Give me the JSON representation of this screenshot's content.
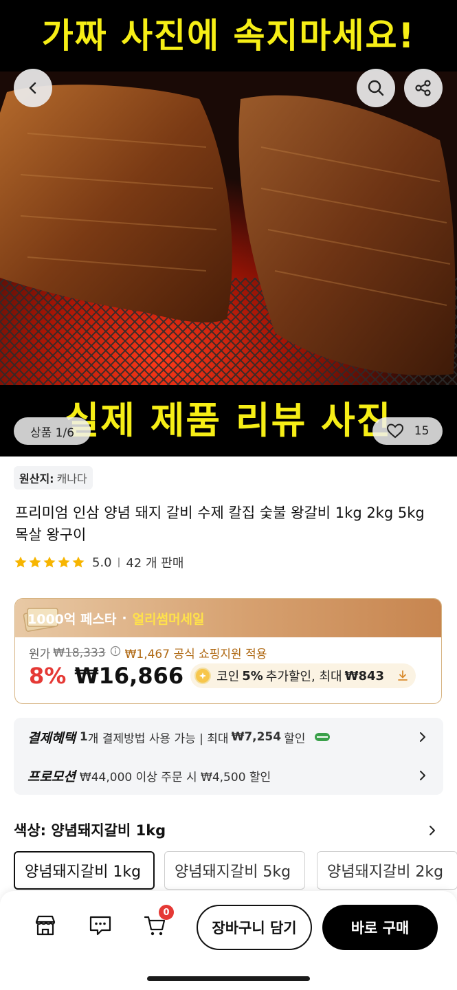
{
  "hero": {
    "banner_top": "가짜 사진에 속지마세요!",
    "banner_bottom": "실제 제품 리뷰 사진",
    "image_counter": "상품 1/6",
    "like_count": "15",
    "back_icon": "chevron-left-icon",
    "search_icon": "search-icon",
    "share_icon": "share-icon"
  },
  "product": {
    "origin_label": "원산지:",
    "origin_value": "캐나다",
    "title": "프리미엄 인삼 양념 돼지 갈비 수제 칼집 숯불 왕갈비 1kg 2kg 5kg 목살 왕구이",
    "rating": "5.0",
    "rating_stars": 5,
    "sales": "42 개 판매"
  },
  "pricing": {
    "festa_label": "1000억 페스타",
    "festa_dot": "·",
    "festa_sale": "얼리썸머세일",
    "original_label": "원가",
    "original_price": "₩18,333",
    "subsidy": "₩1,467 공식 쇼핑지원 적용",
    "discount_pct": "8%",
    "final_price": "₩16,866",
    "coin_text_prefix": "코인",
    "coin_pct": "5%",
    "coin_text_mid": "추가할인, 최대",
    "coin_max": "₩843",
    "accent_color": "#e53935"
  },
  "benefits": {
    "payment_label": "결제혜택",
    "payment_count": "1",
    "payment_text1": "개 결제방법 사용 가능 | 최대",
    "payment_amount": "₩7,254",
    "payment_text2": "할인",
    "promo_label": "프로모션",
    "promo_text": "₩44,000 이상 주문 시 ₩4,500 할인"
  },
  "options": {
    "title": "색상: 양념돼지갈비 1kg",
    "items": [
      "양념돼지갈비 1kg",
      "양념돼지갈비 5kg",
      "양념돼지갈비 2kg"
    ],
    "selected_index": 0
  },
  "bottom_bar": {
    "store_icon": "store-icon",
    "chat_icon": "chat-icon",
    "cart_icon": "cart-icon",
    "cart_badge": "0",
    "add_to_cart": "장바구니 담기",
    "buy_now": "바로 구매"
  }
}
